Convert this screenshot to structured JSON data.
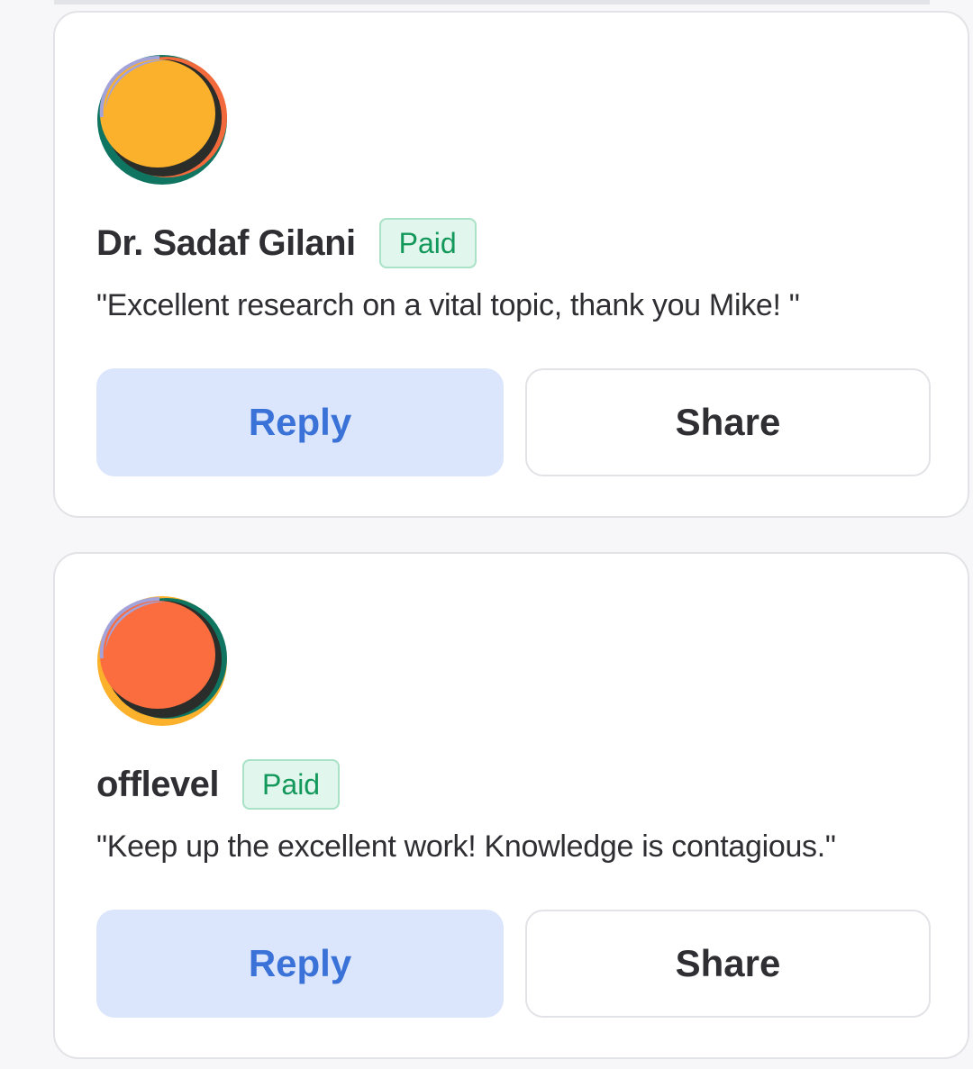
{
  "comments": [
    {
      "author": "Dr. Sadaf Gilani",
      "badge": "Paid",
      "text": "\"Excellent research on a vital topic, thank you Mike! \"",
      "reply_label": "Reply",
      "share_label": "Share",
      "avatar_colors": {
        "main": "#fbb12b",
        "lower": "#0f7561",
        "edge": "#f26a3b",
        "sheen": "#a3a2d9"
      }
    },
    {
      "author": "offlevel",
      "badge": "Paid",
      "text": "\"Keep up the excellent work! Knowledge is contagious.\"",
      "reply_label": "Reply",
      "share_label": "Share",
      "avatar_colors": {
        "main": "#fb6d3e",
        "lower": "#fbb12b",
        "edge": "#0f7561",
        "sheen": "#a3a2d9"
      }
    }
  ],
  "colors": {
    "reply_bg": "#dbe6fd",
    "reply_text": "#3a72d8",
    "badge_bg": "#e1f6ec",
    "badge_text": "#12985a",
    "badge_border": "#a9e2c6",
    "card_border": "#e2e3e7"
  }
}
